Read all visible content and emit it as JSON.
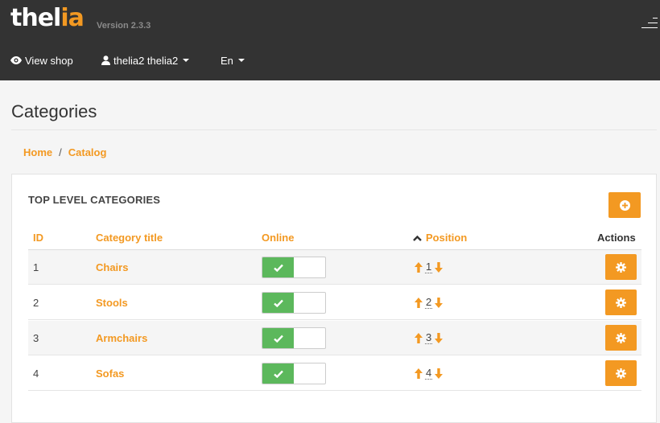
{
  "header": {
    "logo_text_main": "thel",
    "logo_text_accent": "ia",
    "version": "Version 2.3.3",
    "nav": {
      "view_shop": "View shop",
      "user": "thelia2 thelia2",
      "lang": "En"
    }
  },
  "page": {
    "title": "Categories",
    "breadcrumb": [
      {
        "label": "Home"
      },
      {
        "label": "Catalog"
      }
    ],
    "breadcrumb_sep": "/"
  },
  "panel": {
    "title": "TOP LEVEL CATEGORIES",
    "columns": {
      "id": "ID",
      "title": "Category title",
      "online": "Online",
      "position": "Position",
      "actions": "Actions"
    },
    "rows": [
      {
        "id": "1",
        "title": "Chairs",
        "online": true,
        "position": "1"
      },
      {
        "id": "2",
        "title": "Stools",
        "online": true,
        "position": "2"
      },
      {
        "id": "3",
        "title": "Armchairs",
        "online": true,
        "position": "3"
      },
      {
        "id": "4",
        "title": "Sofas",
        "online": true,
        "position": "4"
      }
    ]
  },
  "colors": {
    "accent": "#f39922",
    "topbar": "#333333",
    "online": "#5cb85c"
  }
}
